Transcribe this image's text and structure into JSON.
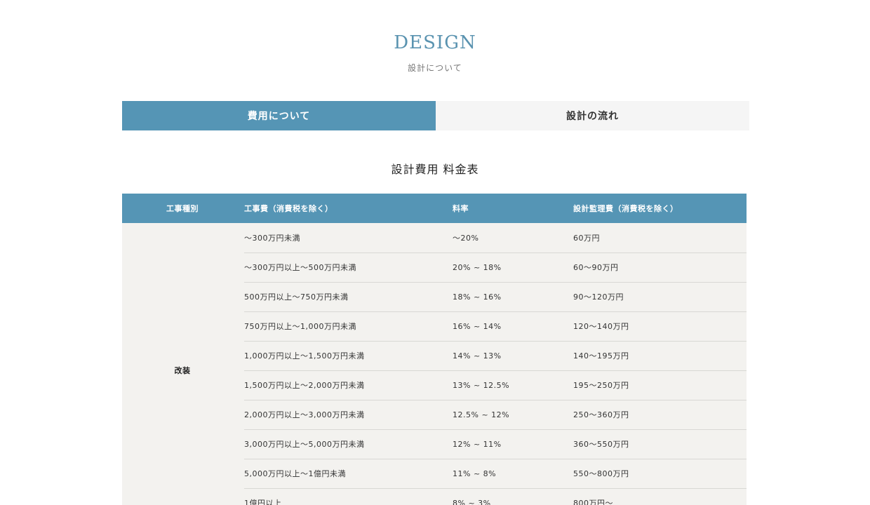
{
  "heading": {
    "en": "DESIGN",
    "ja": "設計について"
  },
  "tabs": [
    {
      "label": "費用について"
    },
    {
      "label": "設計の流れ"
    }
  ],
  "section_title": "設計費用 料金表",
  "table": {
    "headers": [
      "工事種別",
      "工事費（消費税を除く）",
      "料率",
      "設計監理費（消費税を除く）"
    ],
    "type_label": "改装",
    "rows": [
      {
        "cost": "〜300万円未満",
        "rate": "〜20%",
        "fee": "60万円"
      },
      {
        "cost": "〜300万円以上〜500万円未満",
        "rate": "20% ~ 18%",
        "fee": "60〜90万円"
      },
      {
        "cost": "500万円以上〜750万円未満",
        "rate": "18% ~ 16%",
        "fee": "90〜120万円"
      },
      {
        "cost": "750万円以上〜1,000万円未満",
        "rate": "16% ~ 14%",
        "fee": "120〜140万円"
      },
      {
        "cost": "1,000万円以上〜1,500万円未満",
        "rate": "14% ~ 13%",
        "fee": "140〜195万円"
      },
      {
        "cost": "1,500万円以上〜2,000万円未満",
        "rate": "13% ~ 12.5%",
        "fee": "195〜250万円"
      },
      {
        "cost": "2,000万円以上〜3,000万円未満",
        "rate": "12.5% ~ 12%",
        "fee": "250〜360万円"
      },
      {
        "cost": "3,000万円以上〜5,000万円未満",
        "rate": "12% ~ 11%",
        "fee": "360〜550万円"
      },
      {
        "cost": "5,000万円以上〜1億円未満",
        "rate": "11% ~ 8%",
        "fee": "550〜800万円"
      },
      {
        "cost": "1億円以上",
        "rate": "8% ~ 3%",
        "fee": "800万円〜"
      }
    ]
  }
}
